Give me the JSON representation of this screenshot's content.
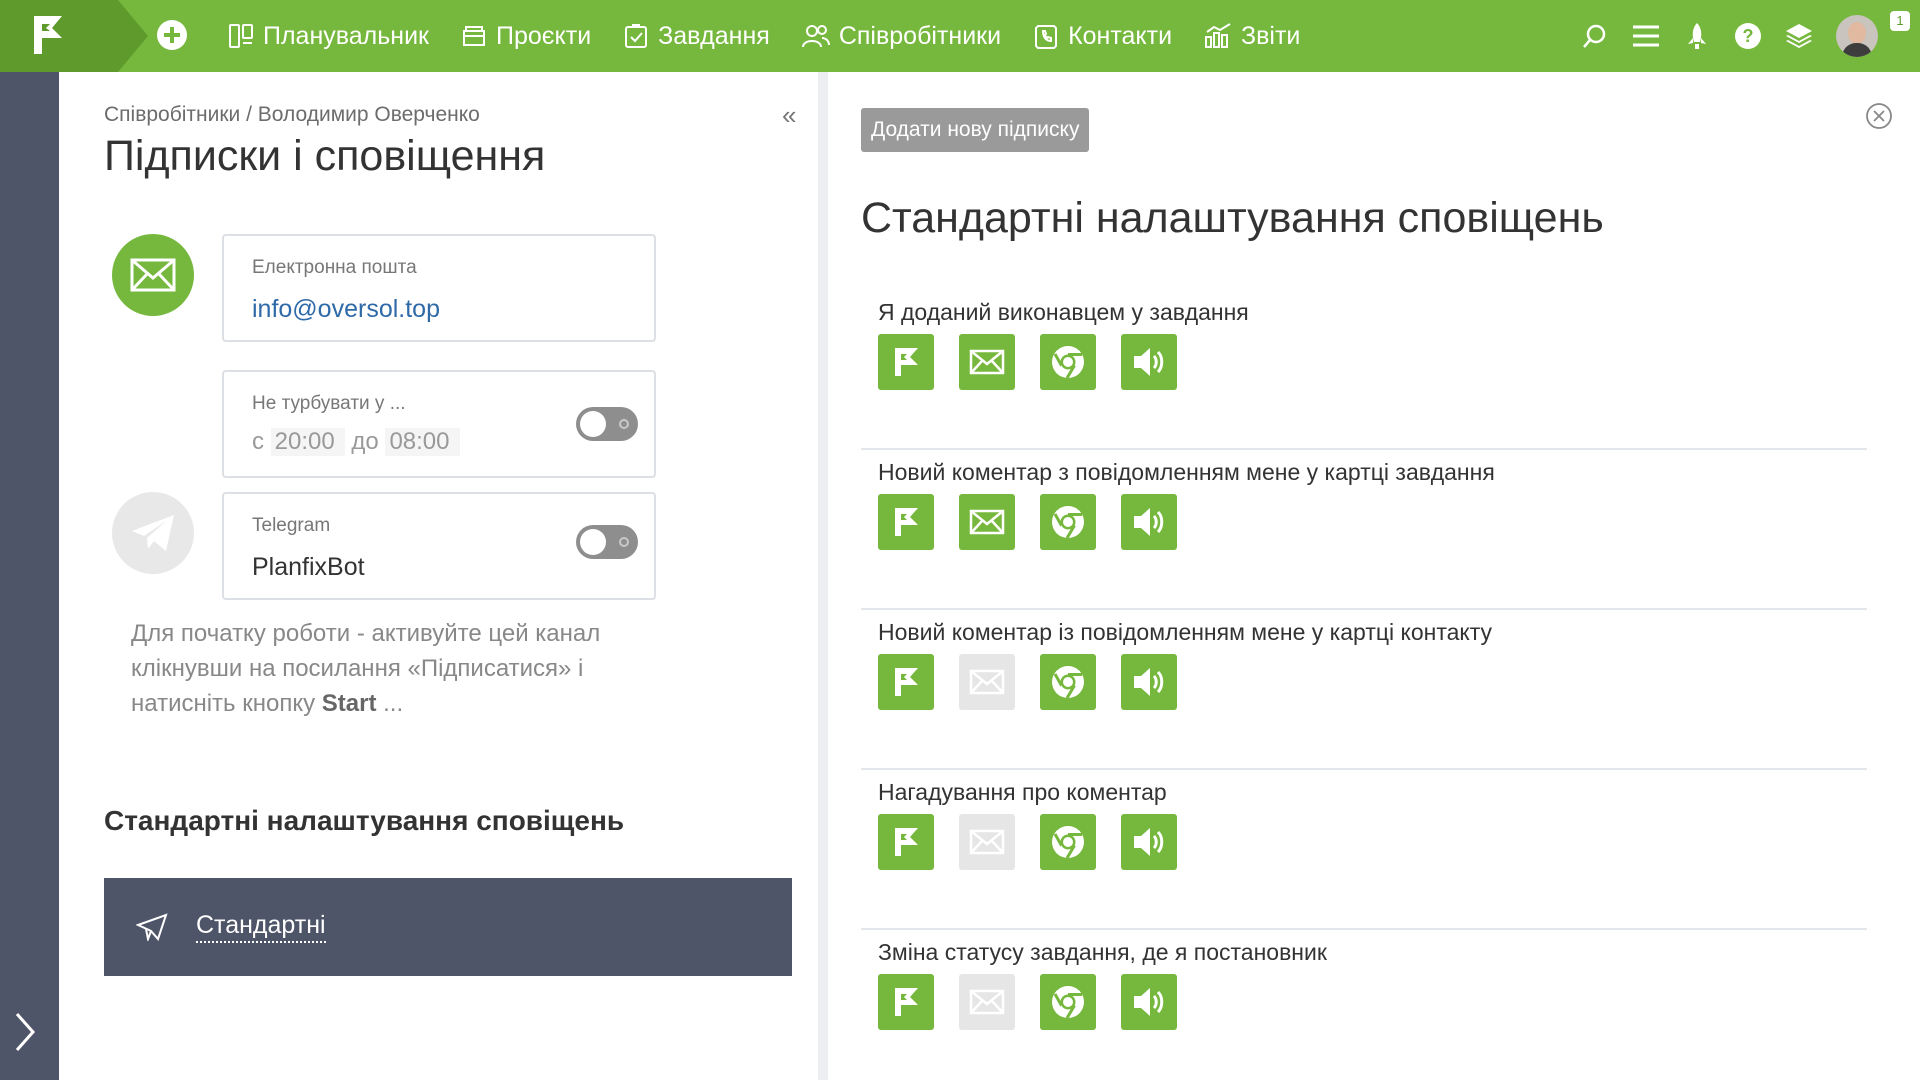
{
  "nav": {
    "items": [
      {
        "label": "Планувальник",
        "icon": "planner-icon"
      },
      {
        "label": "Проєкти",
        "icon": "projects-icon"
      },
      {
        "label": "Завдання",
        "icon": "tasks-icon"
      },
      {
        "label": "Співробітники",
        "icon": "employees-icon"
      },
      {
        "label": "Контакти",
        "icon": "contacts-icon"
      },
      {
        "label": "Звіти",
        "icon": "reports-icon"
      }
    ],
    "badge": "1"
  },
  "left": {
    "breadcrumb": "Співробітники / Володимир Оверченко",
    "title": "Підписки і сповіщення",
    "email": {
      "label": "Електронна пошта",
      "value": "info@oversol.top"
    },
    "dnd": {
      "label": "Не турбувати у ...",
      "from_prefix": "с",
      "from": "20:00",
      "to_prefix": "до",
      "to": "08:00"
    },
    "telegram": {
      "label": "Telegram",
      "value": "PlanfixBot"
    },
    "help_text": "Для початку роботи - активуйте цей канал клікнувши на посилання «Підписатися» і натисніть кнопку ",
    "help_bold": "Start",
    "help_tail": " ...",
    "section_title": "Стандартні налаштування сповіщень",
    "profile": {
      "label": "Стандартні"
    }
  },
  "right": {
    "add_button": "Додати нову підписку",
    "title": "Стандартні налаштування сповіщень",
    "notifications": [
      {
        "label": "Я доданий виконавцем у завдання",
        "channels": {
          "planfix": true,
          "email": true,
          "browser": true,
          "sound": true
        }
      },
      {
        "label": "Новий коментар з повідомленням мене у картці завдання",
        "channels": {
          "planfix": true,
          "email": true,
          "browser": true,
          "sound": true
        }
      },
      {
        "label": "Новий коментар із повідомленням мене у картці контакту",
        "channels": {
          "planfix": true,
          "email": false,
          "browser": true,
          "sound": true
        }
      },
      {
        "label": "Нагадування про коментар",
        "channels": {
          "planfix": true,
          "email": false,
          "browser": true,
          "sound": true
        }
      },
      {
        "label": "Зміна статусу завдання, де я постановник",
        "channels": {
          "planfix": true,
          "email": false,
          "browser": true,
          "sound": true
        }
      }
    ]
  },
  "colors": {
    "brand": "#76b83d",
    "brand_dark": "#5e9b2c",
    "rail": "#4f5569",
    "disabled": "#e6e6e6"
  }
}
